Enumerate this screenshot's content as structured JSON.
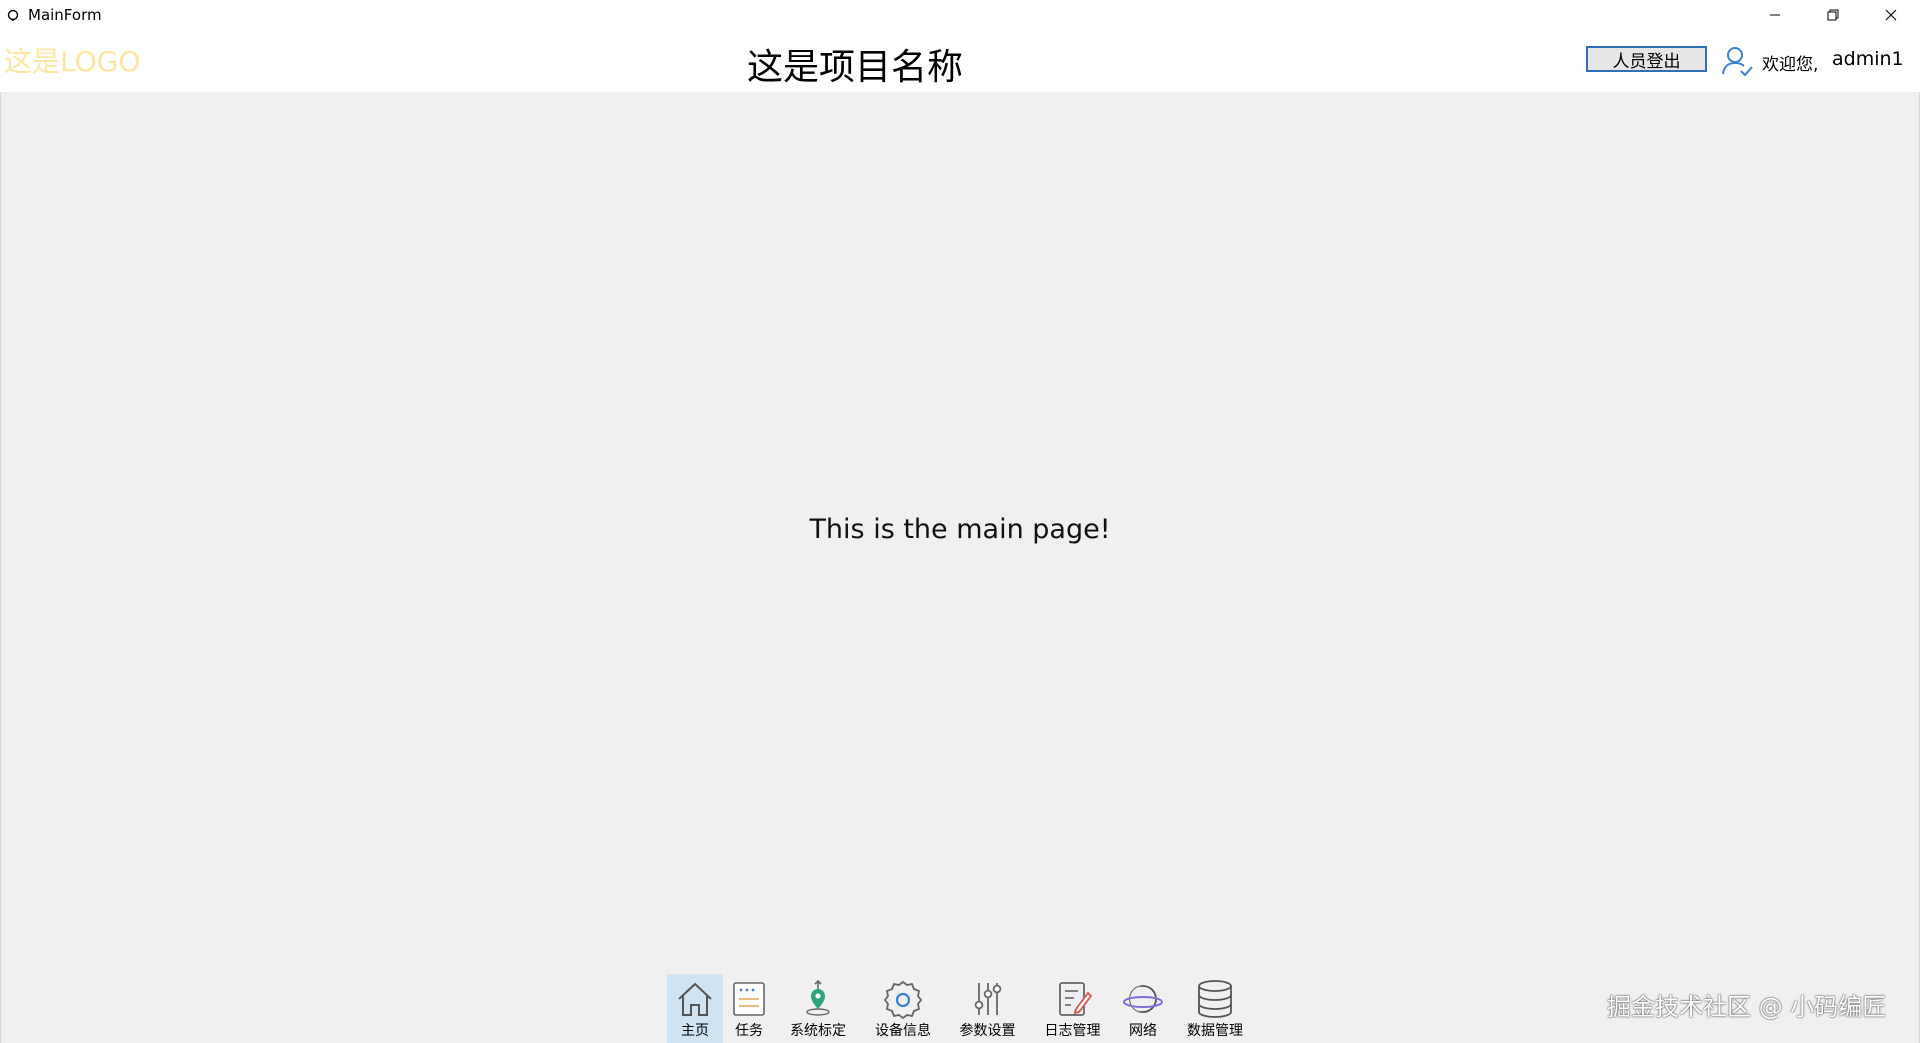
{
  "window": {
    "title": "MainForm"
  },
  "header": {
    "logo": "这是LOGO",
    "project_title": "这是项目名称",
    "logout_label": "人员登出",
    "welcome": "欢迎您,",
    "username": "admin1"
  },
  "main": {
    "message": "This is the main page!"
  },
  "nav": {
    "items": [
      {
        "label": "主页",
        "icon": "home-icon",
        "active": true
      },
      {
        "label": "任务",
        "icon": "task-icon",
        "active": false
      },
      {
        "label": "系统标定",
        "icon": "calibration-icon",
        "active": false
      },
      {
        "label": "设备信息",
        "icon": "device-gear-icon",
        "active": false
      },
      {
        "label": "参数设置",
        "icon": "sliders-icon",
        "active": false
      },
      {
        "label": "日志管理",
        "icon": "log-edit-icon",
        "active": false
      },
      {
        "label": "网络",
        "icon": "network-planet-icon",
        "active": false
      },
      {
        "label": "数据管理",
        "icon": "database-icon",
        "active": false
      }
    ]
  },
  "watermark": "掘金技术社区 @ 小码编匠",
  "colors": {
    "logo": "#fbe7a1",
    "main_bg": "#f0f0f0",
    "nav_active": "#cfe3f3",
    "logout_border": "#2f6fb7",
    "calibration_accent": "#2aa67a",
    "log_accent": "#d9534f"
  }
}
